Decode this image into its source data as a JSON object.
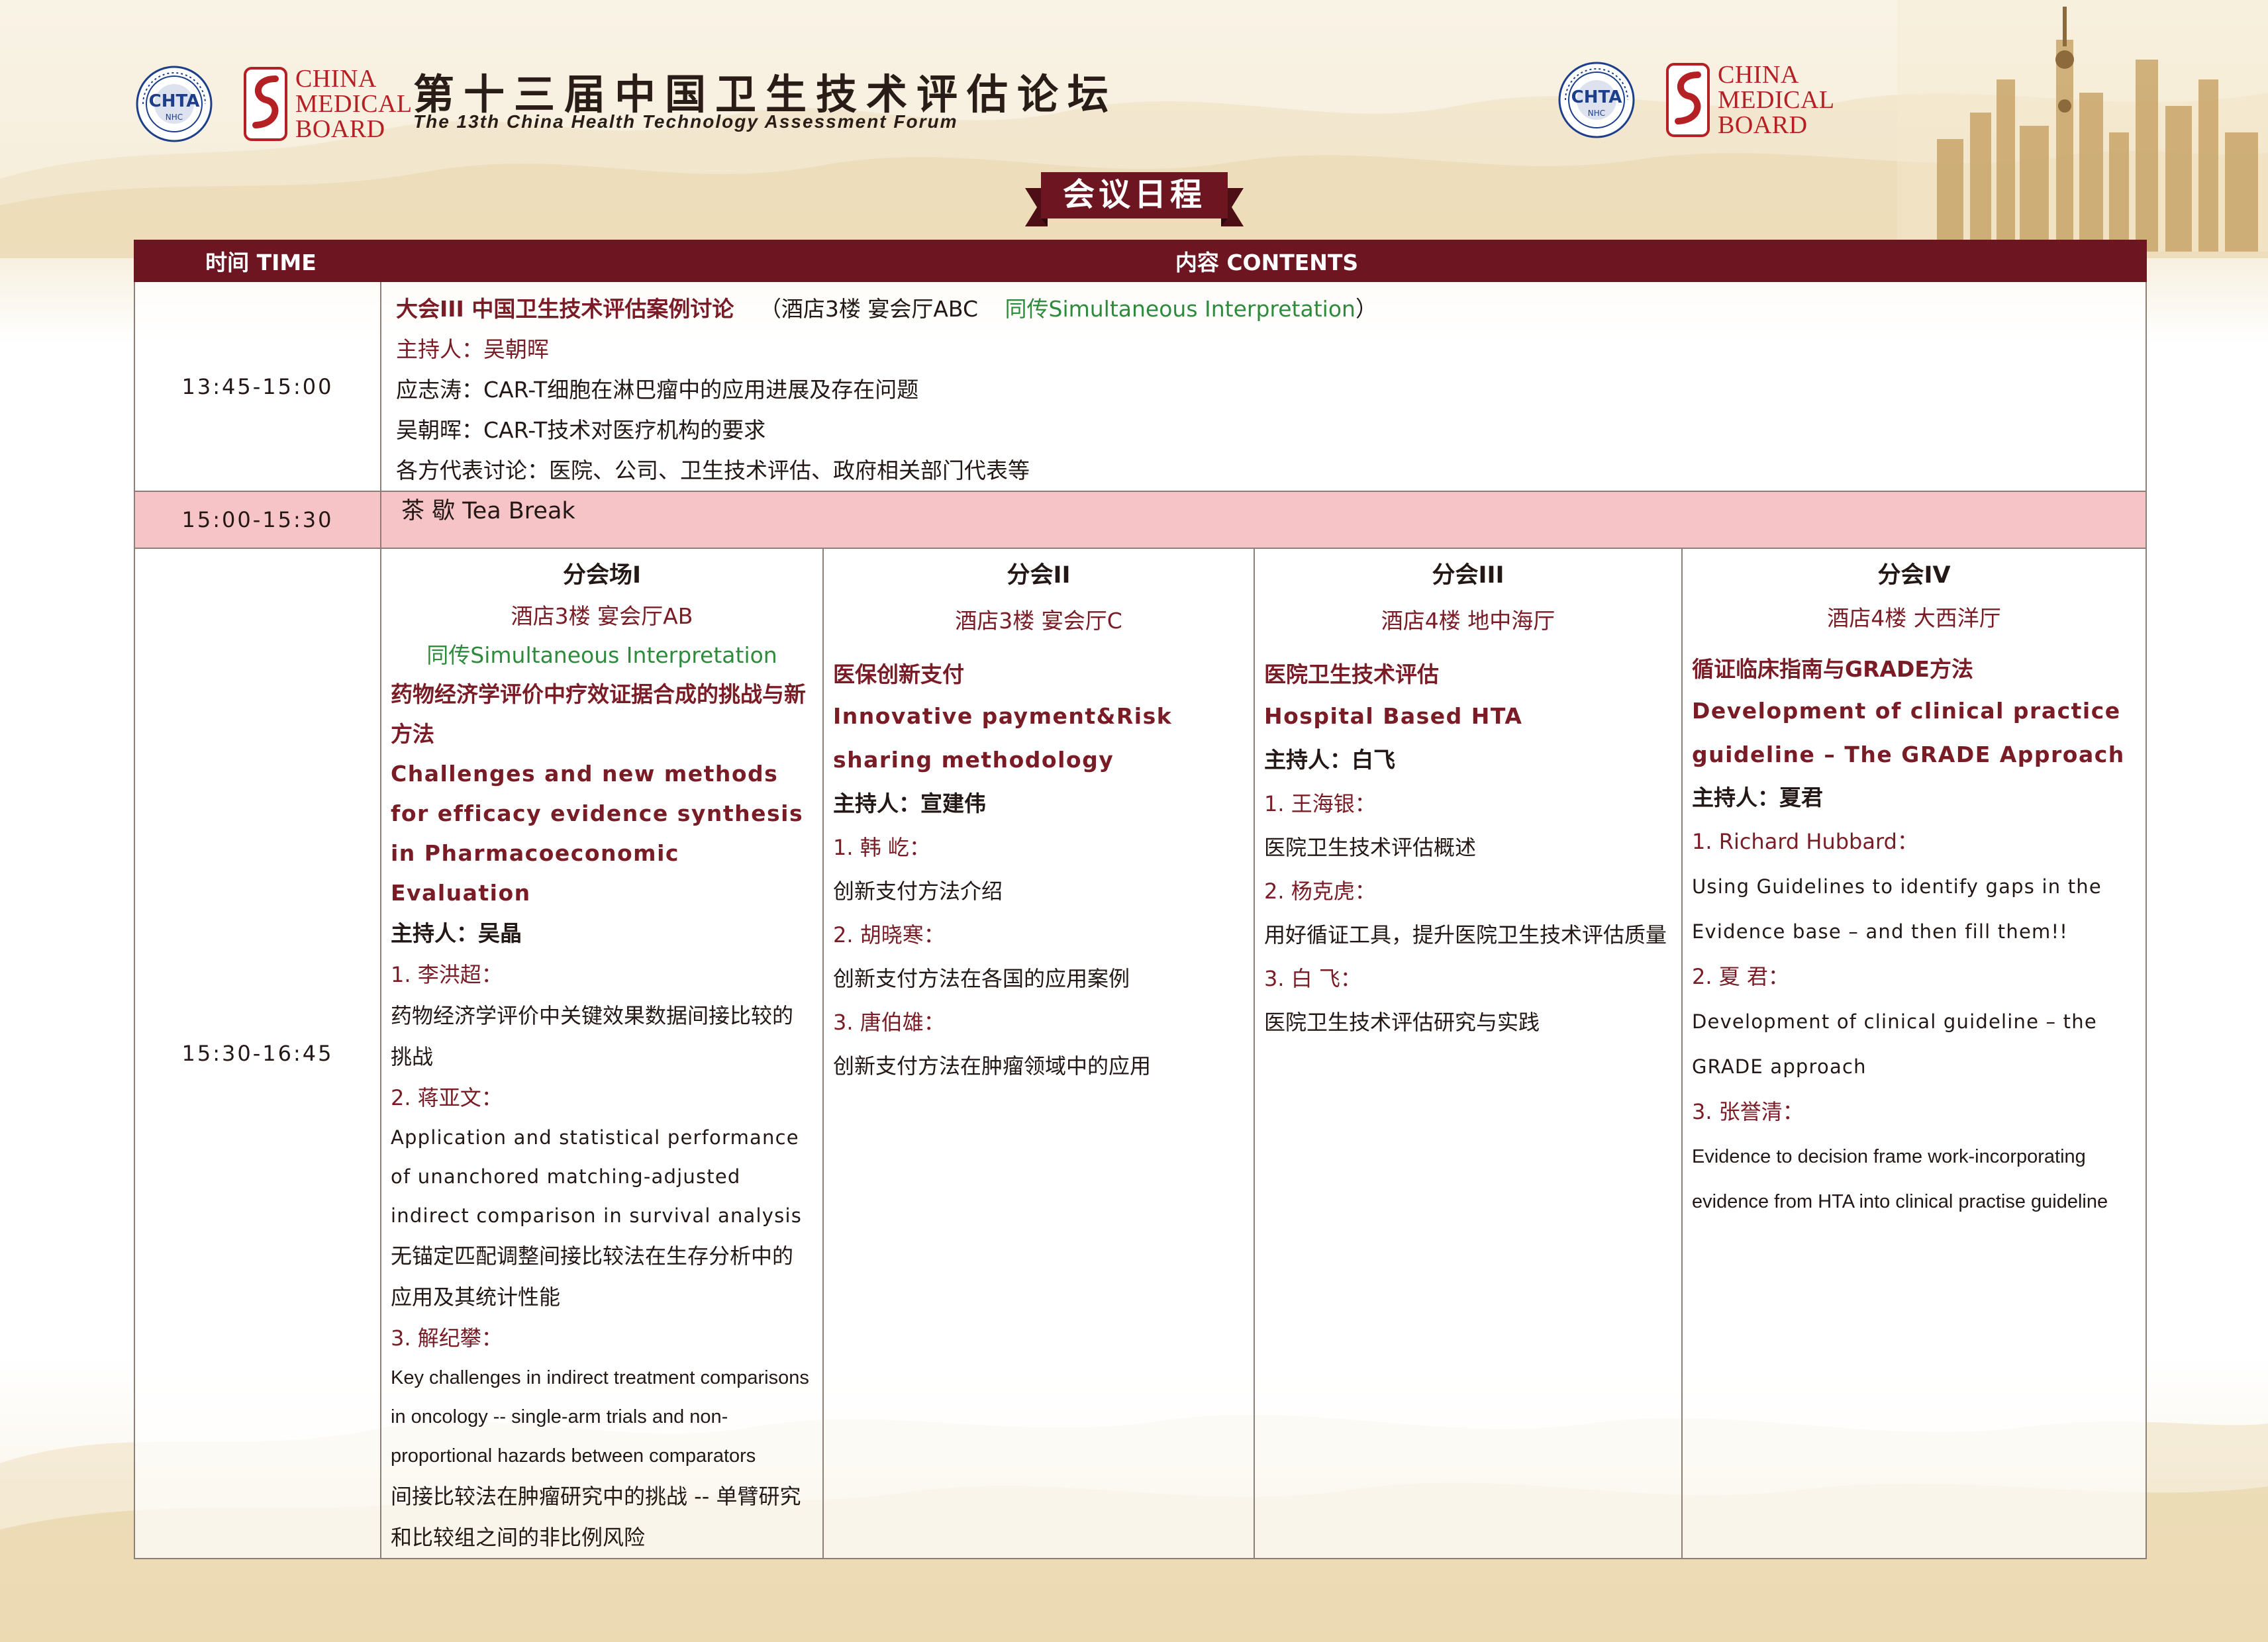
{
  "header": {
    "logo_left": {
      "chta_seal": "CHTA",
      "chta_ring": "FUDAN UNIVERSITY",
      "chta_sub": "NHC",
      "cmb_lines": [
        "CHINA",
        "MEDICAL",
        "BOARD"
      ]
    },
    "logo_right": {
      "chta_seal": "CHTA",
      "chta_ring": "FUDAN UNIVERSITY",
      "chta_sub": "NHC",
      "cmb_lines": [
        "CHINA",
        "MEDICAL",
        "BOARD"
      ]
    },
    "title_cn": "第十三届中国卫生技术评估论坛",
    "title_en": "The 13th China Health Technology Assessment Forum",
    "ribbon_label": "会议日程"
  },
  "table": {
    "col_time": "时间 TIME",
    "col_contents": "内容 CONTENTS",
    "plenary": {
      "time": "13:45-15:00",
      "title": "大会III 中国卫生技术评估案例讨论",
      "venue": "（酒店3楼 宴会厅ABC",
      "interpretation": "同传Simultaneous Interpretation",
      "venue_close": "）",
      "host": "主持人：吴朝晖",
      "lines": [
        "应志涛：CAR-T细胞在淋巴瘤中的应用进展及存在问题",
        "吴朝晖：CAR-T技术对医疗机构的要求",
        "各方代表讨论：医院、公司、卫生技术评估、政府相关部门代表等"
      ]
    },
    "tea_break": {
      "time": "15:00-15:30",
      "label": "茶 歇 Tea Break"
    },
    "sessions_time": "15:30-16:45",
    "sessions": [
      {
        "head": "分会场I",
        "venue": "酒店3楼 宴会厅AB",
        "interpretation": "同传Simultaneous Interpretation",
        "title_cn": "药物经济学评价中疗效证据合成的挑战与新方法",
        "title_en": "Challenges and new methods for efficacy evidence synthesis in Pharmacoeconomic Evaluation",
        "host": "主持人：吴晶",
        "talks": [
          {
            "num": "1. 李洪超：",
            "en": "",
            "cn": "药物经济学评价中关键效果数据间接比较的挑战"
          },
          {
            "num": "2. 蒋亚文：",
            "en": "Application and statistical performance of unanchored matching-adjusted indirect comparison in survival analysis",
            "cn": "无锚定匹配调整间接比较法在生存分析中的应用及其统计性能"
          },
          {
            "num": "3. 解纪攀：",
            "en": "Key challenges in indirect treatment comparisons in oncology -- single-arm trials and non-proportional hazards between comparators",
            "cn": "间接比较法在肿瘤研究中的挑战 -- 单臂研究和比较组之间的非比例风险"
          }
        ]
      },
      {
        "head": "分会II",
        "venue": "酒店3楼 宴会厅C",
        "title_cn": "医保创新支付",
        "title_en": "Innovative payment&Risk sharing methodology",
        "host": "主持人：宣建伟",
        "talks": [
          {
            "num": "1. 韩 屹：",
            "cn": "创新支付方法介绍"
          },
          {
            "num": "2. 胡晓寒：",
            "cn": "创新支付方法在各国的应用案例"
          },
          {
            "num": "3. 唐伯雄：",
            "cn": "创新支付方法在肿瘤领域中的应用"
          }
        ]
      },
      {
        "head": "分会III",
        "venue": "酒店4楼 地中海厅",
        "title_cn": "医院卫生技术评估",
        "title_en": "Hospital Based HTA",
        "host": "主持人：白飞",
        "talks": [
          {
            "num": "1. 王海银：",
            "cn": "医院卫生技术评估概述"
          },
          {
            "num": "2. 杨克虎：",
            "cn": "用好循证工具，提升医院卫生技术评估质量"
          },
          {
            "num": "3. 白 飞：",
            "cn": "医院卫生技术评估研究与实践"
          }
        ]
      },
      {
        "head": "分会IV",
        "venue": "酒店4楼 大西洋厅",
        "title_cn": "循证临床指南与GRADE方法",
        "title_en": "Development of clinical practice guideline – The GRADE Approach",
        "host": "主持人：夏君",
        "talks": [
          {
            "num": "1. Richard Hubbard：",
            "en": "Using Guidelines to identify gaps in the Evidence base – and then fill them!!"
          },
          {
            "num": "2. 夏 君：",
            "en": "Development of clinical guideline – the GRADE approach"
          },
          {
            "num": "3. 张誉清：",
            "en": "Evidence to decision frame work-incorporating evidence from HTA into clinical practise guideline"
          }
        ]
      }
    ]
  },
  "colors": {
    "maroon": "#6d1520",
    "text_maroon": "#7a1c26",
    "green": "#2f8b3c",
    "break_pink": "#f6c3c6",
    "cmb_red": "#b52025",
    "chta_blue": "#1d3f8a"
  }
}
